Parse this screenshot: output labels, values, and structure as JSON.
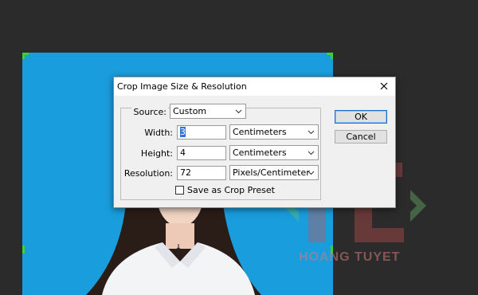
{
  "dialog": {
    "title": "Crop Image Size & Resolution",
    "source_label": "Source:",
    "source_value": "Custom",
    "width_label": "Width:",
    "width_value": "3",
    "width_unit": "Centimeters",
    "height_label": "Height:",
    "height_value": "4",
    "height_unit": "Centimeters",
    "resolution_label": "Resolution:",
    "resolution_value": "72",
    "resolution_unit": "Pixels/Centimeter",
    "save_preset_label": "Save as Crop Preset",
    "save_preset_checked": false,
    "ok_label": "OK",
    "cancel_label": "Cancel"
  },
  "watermark": {
    "text": "HOANG TUYET"
  },
  "icons": {
    "close": "close-icon",
    "dropdown": "chevron-down-icon",
    "cursor": "crosshair-cursor-icon"
  },
  "colors": {
    "workspace": "#2b2b2b",
    "backdrop": "#1a9ddc",
    "crop_handle": "#3ecf3a",
    "dialog_bg": "#f0f0f0",
    "selection": "#3474d8"
  }
}
